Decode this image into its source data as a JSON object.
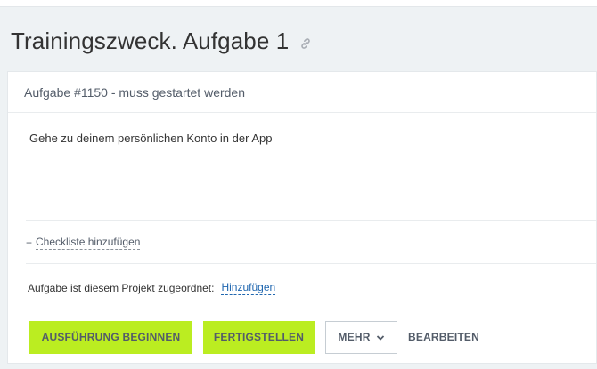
{
  "page": {
    "title": "Trainingszweck. Aufgabe 1",
    "title_icon": "link-icon"
  },
  "task": {
    "header": "Aufgabe #1150 - muss gestartet werden",
    "description": "Gehe zu deinem persönlichen Konto in der App",
    "checklist": {
      "plus": "+",
      "label": "Checkliste hinzufügen"
    },
    "project": {
      "label": "Aufgabe ist diesem Projekt zugeordnet:",
      "add_link": "Hinzufügen"
    }
  },
  "actions": {
    "start": "AUSFÜHRUNG BEGINNEN",
    "finish": "FERTIGSTELLEN",
    "more": "MEHR",
    "more_icon": "chevron-down-icon",
    "edit": "BEARBEITEN"
  },
  "colors": {
    "accent_green": "#bbed21",
    "link_blue": "#2067b0",
    "background": "#eef2f4"
  }
}
